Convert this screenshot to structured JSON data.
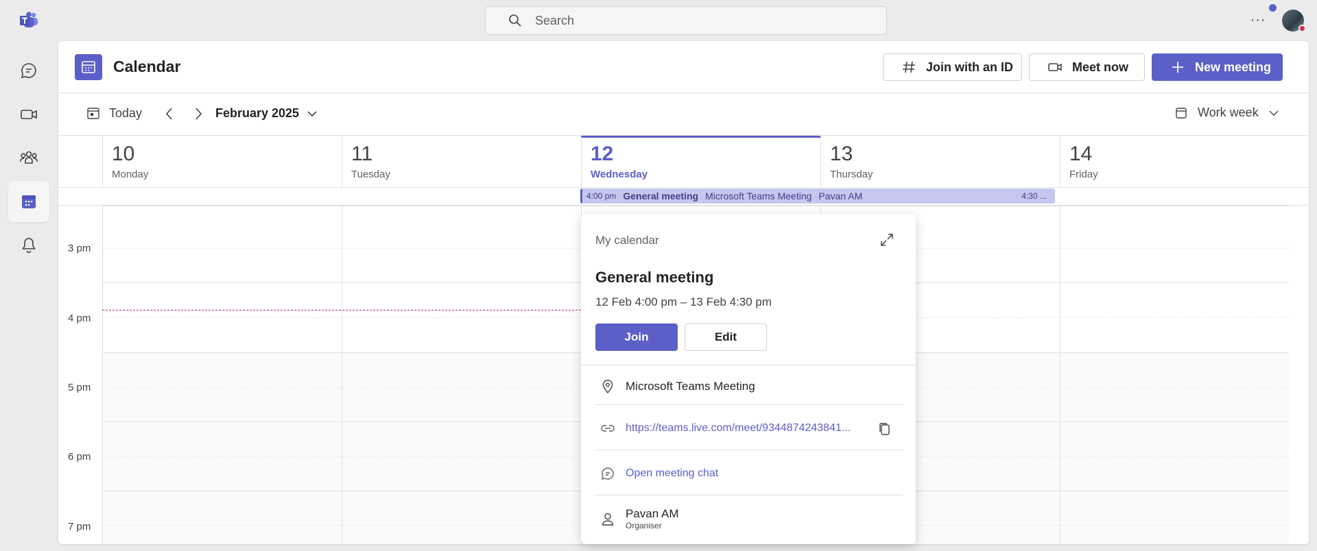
{
  "app": {
    "search_placeholder": "Search",
    "more_label": "···",
    "brand_color": "#5b5fc7"
  },
  "rail": [
    {
      "icon": "chat-icon"
    },
    {
      "icon": "video-icon"
    },
    {
      "icon": "teams-icon"
    },
    {
      "icon": "calendar-icon",
      "active": true
    },
    {
      "icon": "bell-icon"
    }
  ],
  "header": {
    "title": "Calendar",
    "join_id_label": "Join with an ID",
    "meet_now_label": "Meet now",
    "new_meeting_label": "New meeting"
  },
  "toolbar": {
    "today_label": "Today",
    "month_label": "February 2025",
    "view_label": "Work week"
  },
  "days": [
    {
      "num": "10",
      "name": "Monday"
    },
    {
      "num": "11",
      "name": "Tuesday"
    },
    {
      "num": "12",
      "name": "Wednesday",
      "today": true
    },
    {
      "num": "13",
      "name": "Thursday"
    },
    {
      "num": "14",
      "name": "Friday"
    }
  ],
  "time_labels": [
    "3 pm",
    "4 pm",
    "5 pm",
    "6 pm",
    "7 pm"
  ],
  "event": {
    "start": "4:00 pm",
    "title": "General meeting",
    "location": "Microsoft Teams Meeting",
    "organiser": "Pavan AM",
    "end": "4:30 ..."
  },
  "popup": {
    "calendar_name": "My calendar",
    "title": "General meeting",
    "time_range": "12 Feb 4:00 pm – 13 Feb 4:30 pm",
    "join_label": "Join",
    "edit_label": "Edit",
    "location": "Microsoft Teams Meeting",
    "link": "https://teams.live.com/meet/9344874243841...",
    "chat_label": "Open meeting chat",
    "organiser_name": "Pavan AM",
    "organiser_role": "Organiser"
  }
}
